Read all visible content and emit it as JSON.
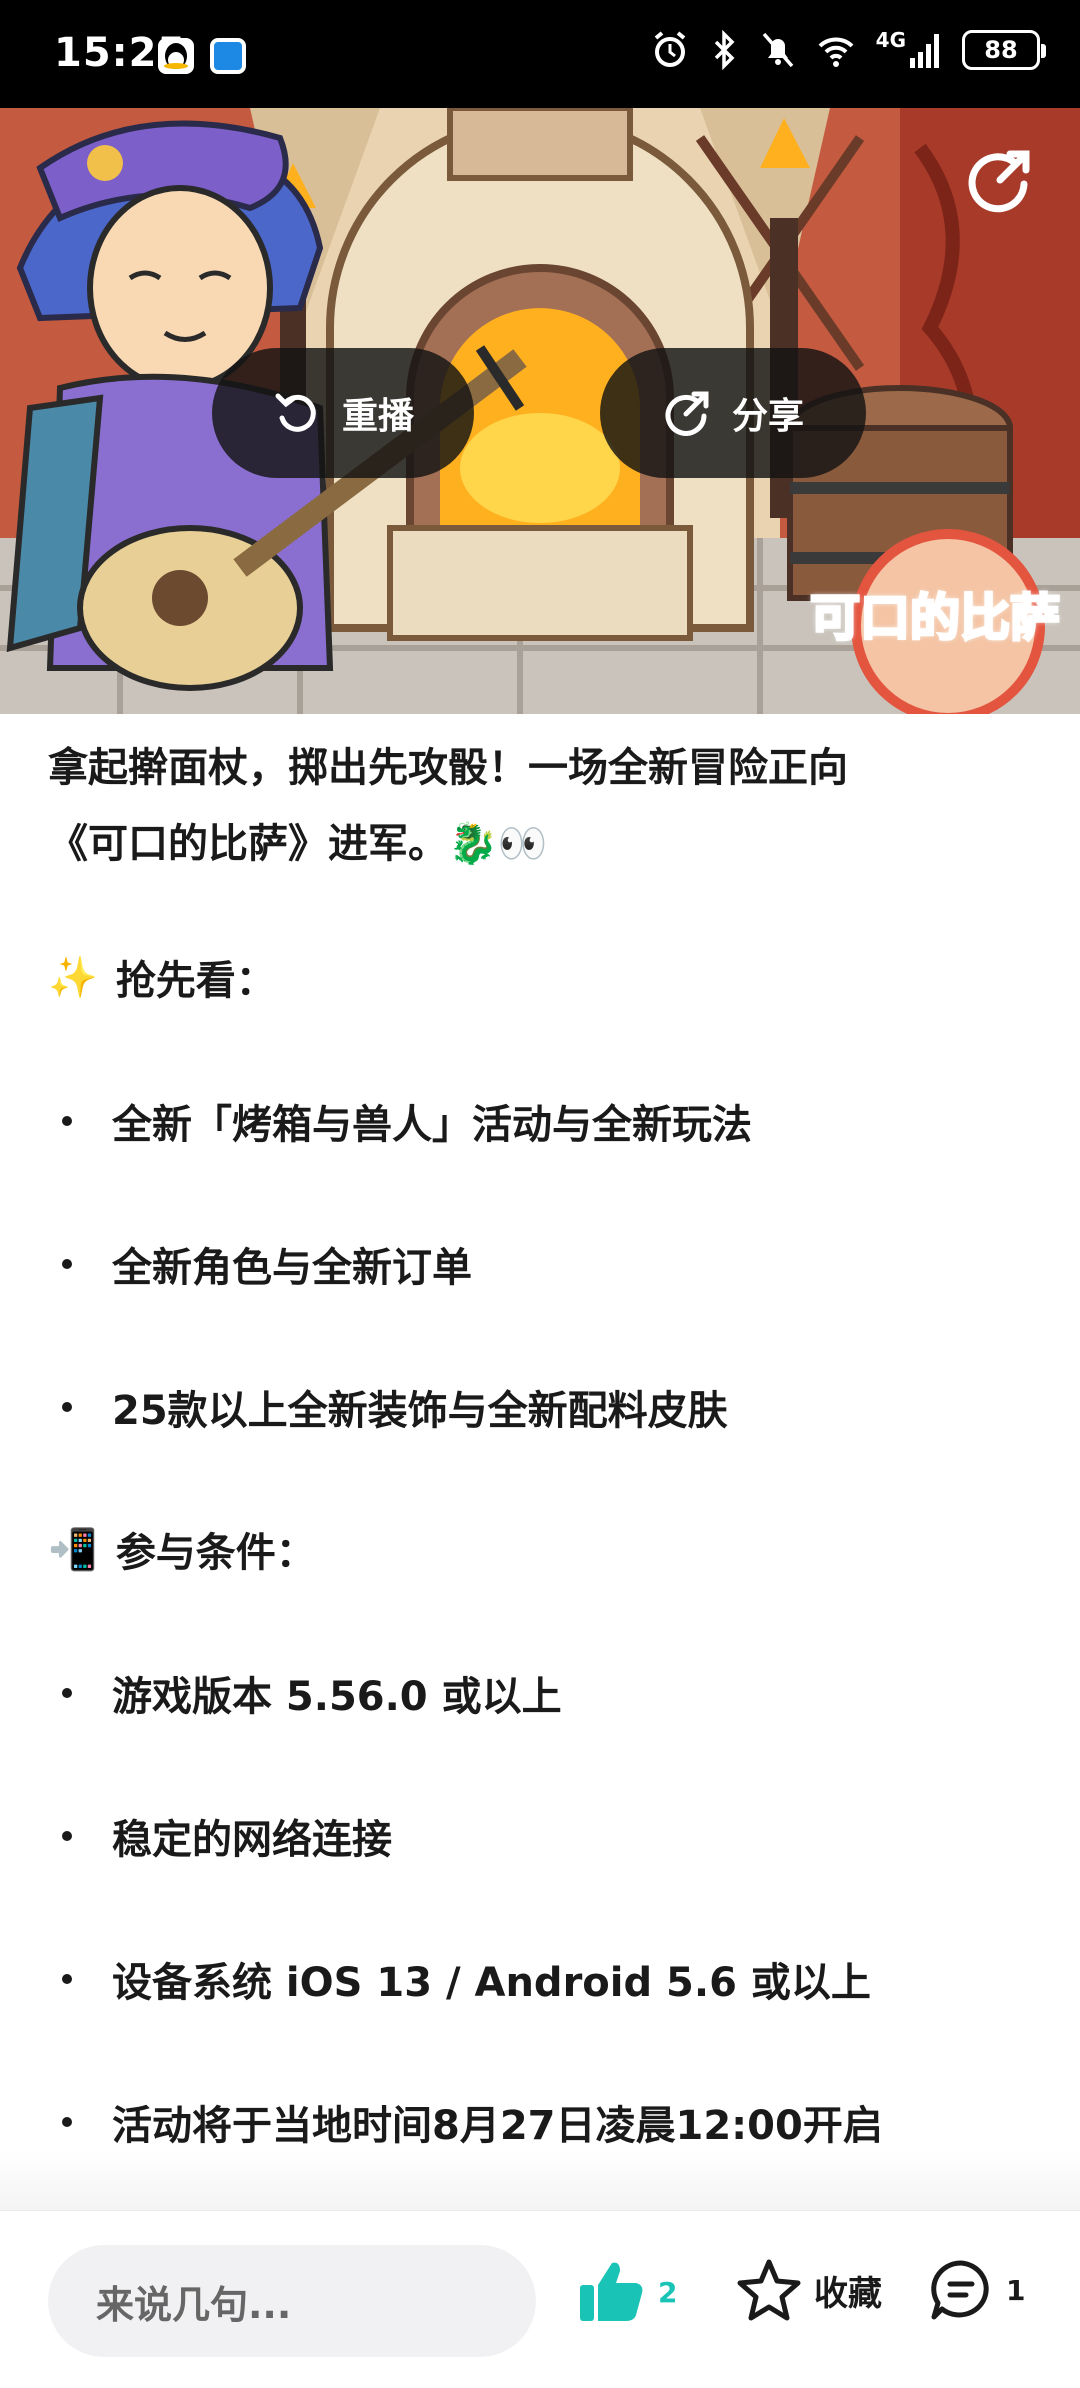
{
  "status_bar": {
    "time": "15:25",
    "network_label": "4G",
    "battery": "88",
    "icons": [
      "qq-icon",
      "browser-icon",
      "alarm-icon",
      "bluetooth-icon",
      "mute-icon",
      "wifi-icon",
      "signal-icon",
      "battery-icon"
    ]
  },
  "banner": {
    "replay_label": "重播",
    "share_label": "分享",
    "game_logo_text": "可口的比萨",
    "icons": [
      "replay-icon",
      "share-icon",
      "corner-share-icon"
    ]
  },
  "post": {
    "intro_line1": "拿起擀面杖，掷出先攻骰！一场全新冒险正向",
    "intro_line2": "《可口的比萨》进军。🐉👀",
    "preview_head_emoji": "✨",
    "preview_head": "抢先看：",
    "preview_items": [
      "全新「烤箱与兽人」活动与全新玩法",
      "全新角色与全新订单",
      "25款以上全新装饰与全新配料皮肤"
    ],
    "req_head_emoji": "📲",
    "req_head": "参与条件：",
    "req_items": [
      "游戏版本 5.56.0 或以上",
      "稳定的网络连接",
      "设备系统 iOS 13 / Android 5.6 或以上",
      "活动将于当地时间8月27日凌晨12:00开启"
    ]
  },
  "bottom_bar": {
    "comment_placeholder": "来说几句...",
    "like_count": "2",
    "collect_label": "收藏",
    "comment_count": "1",
    "colors": {
      "like_accent": "#19c3b6"
    }
  }
}
